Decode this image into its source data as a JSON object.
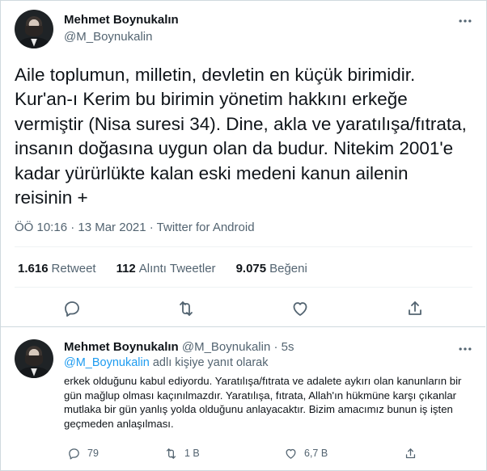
{
  "main_tweet": {
    "author_name": "Mehmet Boynukalın",
    "author_handle": "@M_Boynukalin",
    "text": "Aile toplumun, milletin, devletin en küçük birimidir.\nKur'an-ı Kerim bu birimin yönetim hakkını erkeğe\nvermiştir (Nisa suresi 34). Dine, akla ve yaratılışa/fıtrata,\ninsanın doğasına uygun olan da budur. Nitekim 2001'e\nkadar yürürlükte kalan eski medeni kanun ailenin\nreisinin +",
    "meta": "ÖÖ 10:16 · 13 Mar 2021 · Twitter for Android",
    "stats": {
      "retweets_count": "1.616",
      "retweets_label": "Retweet",
      "quotes_count": "112",
      "quotes_label": "Alıntı Tweetler",
      "likes_count": "9.075",
      "likes_label": "Beğeni"
    },
    "actions": [
      "reply-icon",
      "retweet-icon",
      "like-icon",
      "share-icon"
    ]
  },
  "reply": {
    "author_name": "Mehmet Boynukalın",
    "author_handle": "@M_Boynukalin",
    "time": "· 5s",
    "replying_to_handle": "@M_Boynukalin",
    "replying_suffix": " adlı kişiye yanıt olarak",
    "text": "erkek olduğunu kabul ediyordu. Yaratılışa/fıtrata ve adalete aykırı olan kanunların bir gün mağlup olması kaçınılmazdır. Yaratılışa, fıtrata, Allah'ın hükmüne karşı çıkanlar mutlaka bir gün yanlış yolda olduğunu anlayacaktır. Bizim amacımız bunun iş işten geçmeden anlaşılması.",
    "counts": {
      "replies": "79",
      "retweets": "1 B",
      "likes": "6,7 B"
    }
  },
  "colors": {
    "text": "#0f1419",
    "secondary": "#536471",
    "link": "#1d9bf0",
    "border": "#cfd9de"
  }
}
